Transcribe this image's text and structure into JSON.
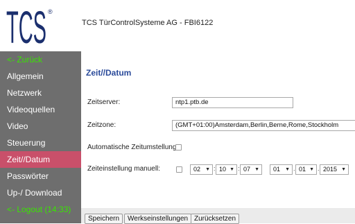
{
  "header": {
    "logo_text": "TCS",
    "logo_mark": "®",
    "title": "TCS TürControlSysteme AG - FBI6122"
  },
  "sidebar": {
    "items": [
      {
        "label": "<- Zurück"
      },
      {
        "label": "Allgemein"
      },
      {
        "label": "Netzwerk"
      },
      {
        "label": "Videoquellen"
      },
      {
        "label": "Video"
      },
      {
        "label": "Steuerung"
      },
      {
        "label": "Zeit//Datum",
        "active": true
      },
      {
        "label": "Passwörter"
      },
      {
        "label": "Up-/ Download"
      },
      {
        "label": "<- Logout (14:33)"
      }
    ]
  },
  "main": {
    "title": "Zeit//Datum",
    "timeserver": {
      "label": "Zeitserver:",
      "value": "ntp1.ptb.de"
    },
    "timezone": {
      "label": "Zeitzone:",
      "value": "(GMT+01:00)Amsterdam,Berlin,Berne,Rome,Stockholm"
    },
    "auto_time": {
      "label": "Automatische Zeitumstellung:",
      "checked": false
    },
    "manual": {
      "label": "Zeiteinstellung manuell:",
      "checked": false,
      "hour": "02",
      "minute": "10",
      "second": "07",
      "day": "01",
      "month": "01",
      "year": "2015"
    }
  },
  "footer": {
    "save": "Speichern",
    "defaults": "Werkseinstellungen",
    "reset": "Zurücksetzen"
  },
  "colors": {
    "sidebar_bg": "#6e6e6e",
    "active_item": "#c9506a",
    "nav_green": "#39e600",
    "title_blue": "#2a4a9a"
  }
}
